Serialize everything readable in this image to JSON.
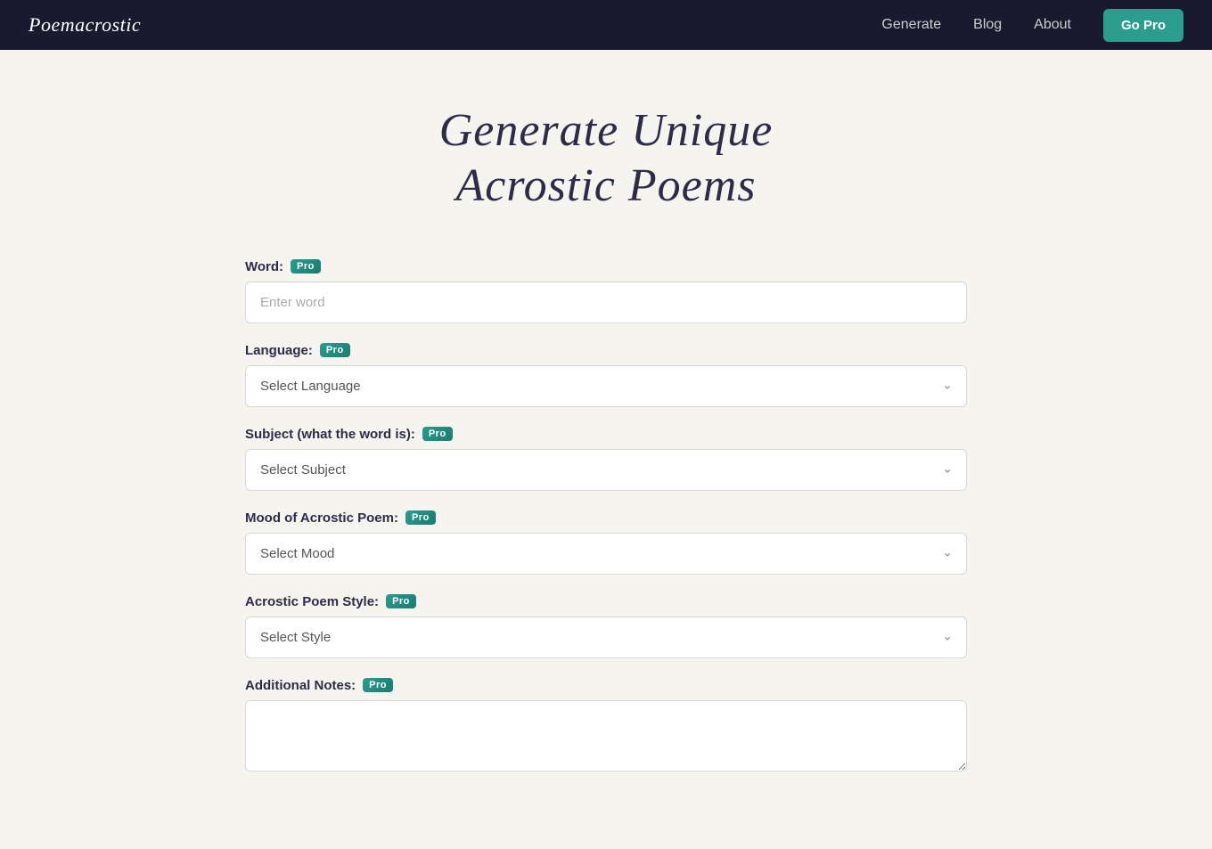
{
  "nav": {
    "logo": "Poemacrostic",
    "links": [
      {
        "label": "Generate",
        "id": "generate"
      },
      {
        "label": "Blog",
        "id": "blog"
      },
      {
        "label": "About",
        "id": "about"
      }
    ],
    "go_pro_label": "Go Pro"
  },
  "hero": {
    "title_line1": "Generate Unique",
    "title_line2": "Acrostic Poems"
  },
  "form": {
    "word_label": "Word:",
    "word_placeholder": "Enter word",
    "language_label": "Language:",
    "language_placeholder": "Select Language",
    "subject_label": "Subject (what the word is):",
    "subject_placeholder": "Select Subject",
    "mood_label": "Mood of Acrostic Poem:",
    "mood_placeholder": "Select Mood",
    "style_label": "Acrostic Poem Style:",
    "style_placeholder": "Select Style",
    "notes_label": "Additional Notes:",
    "pro_badge": "Pro"
  },
  "colors": {
    "nav_bg": "#1a1a2e",
    "body_bg": "#f5f4ef",
    "accent": "#2a9d8f",
    "title_color": "#2c2c4a"
  }
}
